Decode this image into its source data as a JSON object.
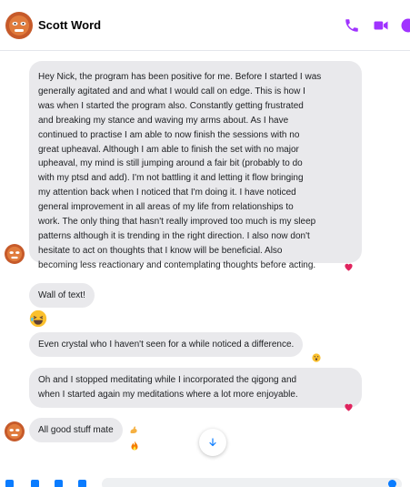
{
  "header": {
    "contact_name": "Scott Word",
    "icons": [
      "avatar-mask",
      "phone-icon",
      "video-icon",
      "info-icon"
    ],
    "accent_color": "#a033ff"
  },
  "messages": [
    {
      "lines": [
        "Hey Nick, the program has been positive for me. Before I started I was",
        "generally agitated and and what I would call on edge. This is how I",
        "was when I started the program also. Constantly getting frustrated",
        "and breaking my stance and waving my arms about. As I have",
        "continued to practise I am able to now finish the sessions with no",
        "great upheaval. Although I am able to finish the set with no major",
        "upheaval, my mind is still jumping around a fair bit (probably to do",
        "with my ptsd and add). I'm not battling it and letting it flow bringing",
        "my attention back when I noticed that I'm doing it. I have noticed",
        "general improvement in all areas of my life from relationships to",
        "work. The only thing that hasn't really improved too much is my sleep",
        "patterns although it is trending in the right direction. I also now don't",
        "hesitate to act on thoughts that I know will be beneficial. Also",
        "becoming less reactionary and contemplating thoughts before acting."
      ],
      "reaction": "heart"
    },
    {
      "text": "Wall of text!"
    },
    {
      "emoji": "laughing-face"
    },
    {
      "text": "Even crystal who I haven't seen for a while noticed a difference.",
      "reaction": "wow-face"
    },
    {
      "lines": [
        "Oh and I stopped meditating while I incorporated the qigong and",
        "when I started again my meditations where a lot more enjoyable."
      ],
      "reaction": "heart"
    },
    {
      "text": "All good stuff mate",
      "reaction": "fire"
    }
  ],
  "colors": {
    "bubble": "#e9e9ec",
    "accent": "#a033ff",
    "heart": "#e0245e",
    "link": "#0a7cff"
  }
}
